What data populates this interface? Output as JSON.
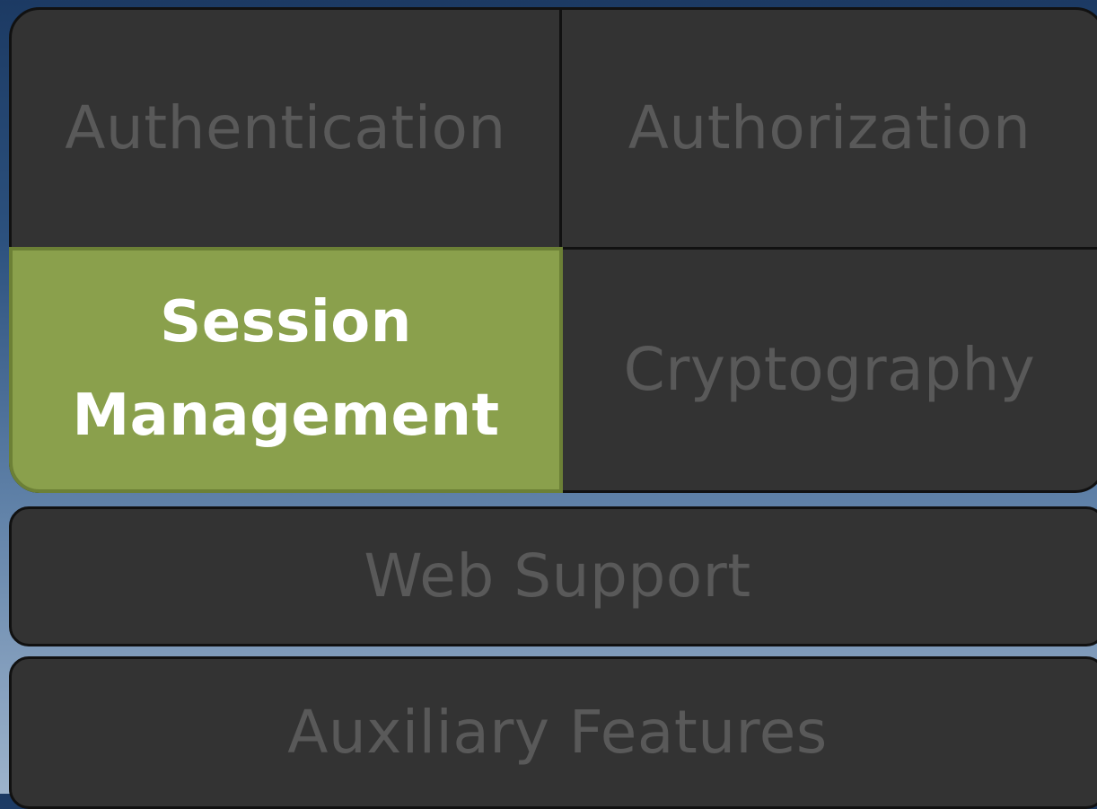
{
  "diagram": {
    "blocks": {
      "authentication": "Authentication",
      "authorization": "Authorization",
      "session_management": {
        "line1": "Session",
        "line2": "Management"
      },
      "cryptography": "Cryptography",
      "web_support": "Web Support",
      "auxiliary_features": "Auxiliary Features"
    },
    "highlighted": "Session Management",
    "colors": {
      "panel": "#333333",
      "panel_text": "#595959",
      "highlight": "#8aa04c",
      "highlight_text": "#ffffff",
      "border": "#111111"
    }
  }
}
